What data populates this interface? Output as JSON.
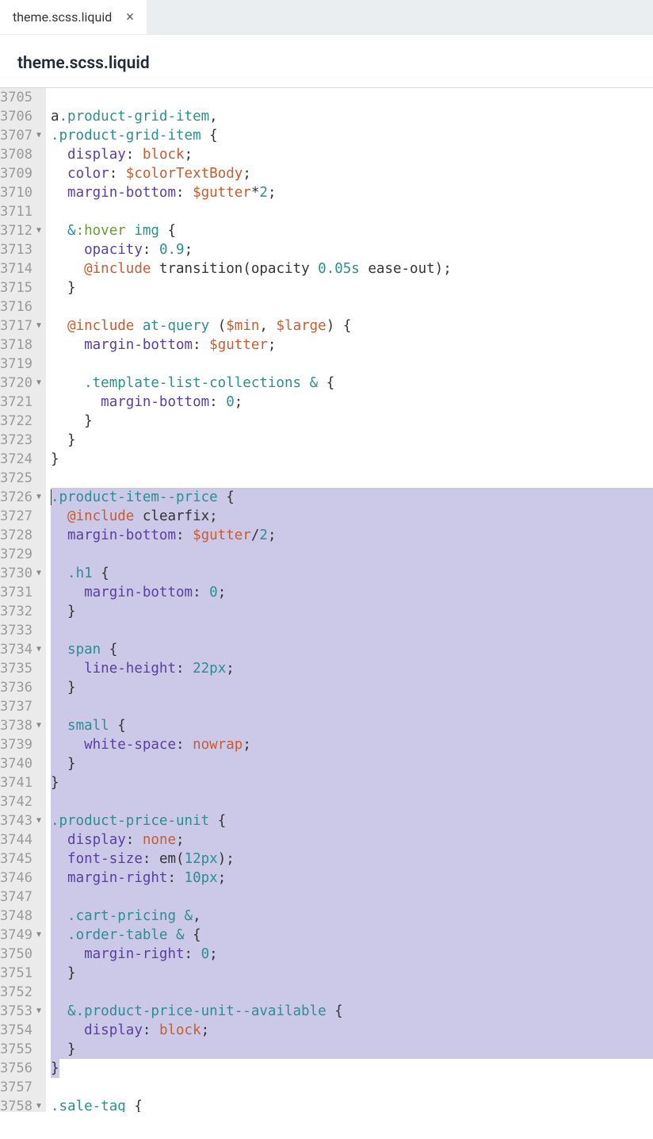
{
  "tab": {
    "label": "theme.scss.liquid",
    "close": "×"
  },
  "breadcrumb": "theme.scss.liquid",
  "gutter": {
    "start": 3705,
    "foldable": [
      3707,
      3712,
      3717,
      3720,
      3726,
      3730,
      3734,
      3738,
      3743,
      3749,
      3753,
      3758
    ]
  },
  "selection": {
    "start": 3726,
    "end": 3756
  },
  "lines": [
    {
      "n": 3705,
      "t": [
        [
          "",
          ""
        ]
      ]
    },
    {
      "n": 3706,
      "t": [
        [
          "a",
          "ident"
        ],
        [
          ".product-grid-item",
          "tag"
        ],
        [
          ",",
          "punc"
        ]
      ]
    },
    {
      "n": 3707,
      "t": [
        [
          ".product-grid-item",
          "tag"
        ],
        [
          " ",
          "ident"
        ],
        [
          "{",
          "punc"
        ]
      ]
    },
    {
      "n": 3708,
      "t": [
        [
          "  ",
          "ident"
        ],
        [
          "display",
          "prop"
        ],
        [
          ": ",
          "punc"
        ],
        [
          "block",
          "val"
        ],
        [
          ";",
          "punc"
        ]
      ]
    },
    {
      "n": 3709,
      "t": [
        [
          "  ",
          "ident"
        ],
        [
          "color",
          "prop"
        ],
        [
          ": ",
          "punc"
        ],
        [
          "$colorTextBody",
          "val"
        ],
        [
          ";",
          "punc"
        ]
      ]
    },
    {
      "n": 3710,
      "t": [
        [
          "  ",
          "ident"
        ],
        [
          "margin-bottom",
          "prop"
        ],
        [
          ": ",
          "punc"
        ],
        [
          "$gutter",
          "val"
        ],
        [
          "*",
          "punc"
        ],
        [
          "2",
          "num"
        ],
        [
          ";",
          "punc"
        ]
      ]
    },
    {
      "n": 3711,
      "t": [
        [
          "",
          ""
        ]
      ]
    },
    {
      "n": 3712,
      "t": [
        [
          "  ",
          "ident"
        ],
        [
          "&",
          "tag"
        ],
        [
          ":hover",
          "pseudo"
        ],
        [
          " ",
          "ident"
        ],
        [
          "img",
          "tag"
        ],
        [
          " ",
          "ident"
        ],
        [
          "{",
          "punc"
        ]
      ]
    },
    {
      "n": 3713,
      "t": [
        [
          "    ",
          "ident"
        ],
        [
          "opacity",
          "prop"
        ],
        [
          ": ",
          "punc"
        ],
        [
          "0.9",
          "num"
        ],
        [
          ";",
          "punc"
        ]
      ]
    },
    {
      "n": 3714,
      "t": [
        [
          "    ",
          "ident"
        ],
        [
          "@include",
          "kw"
        ],
        [
          " ",
          "ident"
        ],
        [
          "transition",
          "ident"
        ],
        [
          "(",
          "punc"
        ],
        [
          "opacity ",
          "ident"
        ],
        [
          "0.05s",
          "num"
        ],
        [
          " ease-out",
          "ident"
        ],
        [
          ")",
          "punc"
        ],
        [
          ";",
          "punc"
        ]
      ]
    },
    {
      "n": 3715,
      "t": [
        [
          "  ",
          "ident"
        ],
        [
          "}",
          "punc"
        ]
      ]
    },
    {
      "n": 3716,
      "t": [
        [
          "",
          ""
        ]
      ]
    },
    {
      "n": 3717,
      "t": [
        [
          "  ",
          "ident"
        ],
        [
          "@include",
          "kw"
        ],
        [
          " ",
          "ident"
        ],
        [
          "at-query",
          "tag"
        ],
        [
          " ",
          "ident"
        ],
        [
          "(",
          "punc"
        ],
        [
          "$min",
          "val"
        ],
        [
          ", ",
          "punc"
        ],
        [
          "$large",
          "val"
        ],
        [
          ")",
          "punc"
        ],
        [
          " ",
          "ident"
        ],
        [
          "{",
          "punc"
        ]
      ]
    },
    {
      "n": 3718,
      "t": [
        [
          "    ",
          "ident"
        ],
        [
          "margin-bottom",
          "prop"
        ],
        [
          ": ",
          "punc"
        ],
        [
          "$gutter",
          "val"
        ],
        [
          ";",
          "punc"
        ]
      ]
    },
    {
      "n": 3719,
      "t": [
        [
          "",
          ""
        ]
      ]
    },
    {
      "n": 3720,
      "t": [
        [
          "    ",
          "ident"
        ],
        [
          ".template-list-collections",
          "tag"
        ],
        [
          " ",
          "ident"
        ],
        [
          "&",
          "tag"
        ],
        [
          " ",
          "ident"
        ],
        [
          "{",
          "punc"
        ]
      ]
    },
    {
      "n": 3721,
      "t": [
        [
          "      ",
          "ident"
        ],
        [
          "margin-bottom",
          "prop"
        ],
        [
          ": ",
          "punc"
        ],
        [
          "0",
          "num"
        ],
        [
          ";",
          "punc"
        ]
      ]
    },
    {
      "n": 3722,
      "t": [
        [
          "    ",
          "ident"
        ],
        [
          "}",
          "punc"
        ]
      ]
    },
    {
      "n": 3723,
      "t": [
        [
          "  ",
          "ident"
        ],
        [
          "}",
          "punc"
        ]
      ]
    },
    {
      "n": 3724,
      "t": [
        [
          "}",
          "punc"
        ]
      ]
    },
    {
      "n": 3725,
      "t": [
        [
          "",
          ""
        ]
      ]
    },
    {
      "n": 3726,
      "t": [
        [
          ".product-item--price",
          "tag"
        ],
        [
          " ",
          "ident"
        ],
        [
          "{",
          "punc"
        ]
      ]
    },
    {
      "n": 3727,
      "t": [
        [
          "  ",
          "ident"
        ],
        [
          "@include",
          "kw"
        ],
        [
          " ",
          "ident"
        ],
        [
          "clearfix",
          "ident"
        ],
        [
          ";",
          "punc"
        ]
      ]
    },
    {
      "n": 3728,
      "t": [
        [
          "  ",
          "ident"
        ],
        [
          "margin-bottom",
          "prop"
        ],
        [
          ": ",
          "punc"
        ],
        [
          "$gutter",
          "val"
        ],
        [
          "/",
          "punc"
        ],
        [
          "2",
          "num"
        ],
        [
          ";",
          "punc"
        ]
      ]
    },
    {
      "n": 3729,
      "t": [
        [
          "",
          ""
        ]
      ]
    },
    {
      "n": 3730,
      "t": [
        [
          "  ",
          "ident"
        ],
        [
          ".h1",
          "tag"
        ],
        [
          " ",
          "ident"
        ],
        [
          "{",
          "punc"
        ]
      ]
    },
    {
      "n": 3731,
      "t": [
        [
          "    ",
          "ident"
        ],
        [
          "margin-bottom",
          "prop"
        ],
        [
          ": ",
          "punc"
        ],
        [
          "0",
          "num"
        ],
        [
          ";",
          "punc"
        ]
      ]
    },
    {
      "n": 3732,
      "t": [
        [
          "  ",
          "ident"
        ],
        [
          "}",
          "punc"
        ]
      ]
    },
    {
      "n": 3733,
      "t": [
        [
          "",
          ""
        ]
      ]
    },
    {
      "n": 3734,
      "t": [
        [
          "  ",
          "ident"
        ],
        [
          "span",
          "tag"
        ],
        [
          " ",
          "ident"
        ],
        [
          "{",
          "punc"
        ]
      ]
    },
    {
      "n": 3735,
      "t": [
        [
          "    ",
          "ident"
        ],
        [
          "line-height",
          "prop"
        ],
        [
          ": ",
          "punc"
        ],
        [
          "22px",
          "num"
        ],
        [
          ";",
          "punc"
        ]
      ]
    },
    {
      "n": 3736,
      "t": [
        [
          "  ",
          "ident"
        ],
        [
          "}",
          "punc"
        ]
      ]
    },
    {
      "n": 3737,
      "t": [
        [
          "",
          ""
        ]
      ]
    },
    {
      "n": 3738,
      "t": [
        [
          "  ",
          "ident"
        ],
        [
          "small",
          "tag"
        ],
        [
          " ",
          "ident"
        ],
        [
          "{",
          "punc"
        ]
      ]
    },
    {
      "n": 3739,
      "t": [
        [
          "    ",
          "ident"
        ],
        [
          "white-space",
          "prop"
        ],
        [
          ": ",
          "punc"
        ],
        [
          "nowrap",
          "val"
        ],
        [
          ";",
          "punc"
        ]
      ]
    },
    {
      "n": 3740,
      "t": [
        [
          "  ",
          "ident"
        ],
        [
          "}",
          "punc"
        ]
      ]
    },
    {
      "n": 3741,
      "t": [
        [
          "}",
          "punc"
        ]
      ]
    },
    {
      "n": 3742,
      "t": [
        [
          "",
          ""
        ]
      ]
    },
    {
      "n": 3743,
      "t": [
        [
          ".product-price-unit",
          "tag"
        ],
        [
          " ",
          "ident"
        ],
        [
          "{",
          "punc"
        ]
      ]
    },
    {
      "n": 3744,
      "t": [
        [
          "  ",
          "ident"
        ],
        [
          "display",
          "prop"
        ],
        [
          ": ",
          "punc"
        ],
        [
          "none",
          "val"
        ],
        [
          ";",
          "punc"
        ]
      ]
    },
    {
      "n": 3745,
      "t": [
        [
          "  ",
          "ident"
        ],
        [
          "font-size",
          "prop"
        ],
        [
          ": ",
          "punc"
        ],
        [
          "em",
          "ident"
        ],
        [
          "(",
          "punc"
        ],
        [
          "12px",
          "num"
        ],
        [
          ")",
          "punc"
        ],
        [
          ";",
          "punc"
        ]
      ]
    },
    {
      "n": 3746,
      "t": [
        [
          "  ",
          "ident"
        ],
        [
          "margin-right",
          "prop"
        ],
        [
          ": ",
          "punc"
        ],
        [
          "10px",
          "num"
        ],
        [
          ";",
          "punc"
        ]
      ]
    },
    {
      "n": 3747,
      "t": [
        [
          "",
          ""
        ]
      ]
    },
    {
      "n": 3748,
      "t": [
        [
          "  ",
          "ident"
        ],
        [
          ".cart-pricing",
          "tag"
        ],
        [
          " ",
          "ident"
        ],
        [
          "&",
          "tag"
        ],
        [
          ",",
          "punc"
        ]
      ]
    },
    {
      "n": 3749,
      "t": [
        [
          "  ",
          "ident"
        ],
        [
          ".order-table",
          "tag"
        ],
        [
          " ",
          "ident"
        ],
        [
          "&",
          "tag"
        ],
        [
          " ",
          "ident"
        ],
        [
          "{",
          "punc"
        ]
      ]
    },
    {
      "n": 3750,
      "t": [
        [
          "    ",
          "ident"
        ],
        [
          "margin-right",
          "prop"
        ],
        [
          ": ",
          "punc"
        ],
        [
          "0",
          "num"
        ],
        [
          ";",
          "punc"
        ]
      ]
    },
    {
      "n": 3751,
      "t": [
        [
          "  ",
          "ident"
        ],
        [
          "}",
          "punc"
        ]
      ]
    },
    {
      "n": 3752,
      "t": [
        [
          "",
          ""
        ]
      ]
    },
    {
      "n": 3753,
      "t": [
        [
          "  ",
          "ident"
        ],
        [
          "&",
          "tag"
        ],
        [
          ".product-price-unit--available",
          "tag"
        ],
        [
          " ",
          "ident"
        ],
        [
          "{",
          "punc"
        ]
      ]
    },
    {
      "n": 3754,
      "t": [
        [
          "    ",
          "ident"
        ],
        [
          "display",
          "prop"
        ],
        [
          ": ",
          "punc"
        ],
        [
          "block",
          "val"
        ],
        [
          ";",
          "punc"
        ]
      ]
    },
    {
      "n": 3755,
      "t": [
        [
          "  ",
          "ident"
        ],
        [
          "}",
          "punc"
        ]
      ]
    },
    {
      "n": 3756,
      "t": [
        [
          "}",
          "punc"
        ]
      ]
    },
    {
      "n": 3757,
      "t": [
        [
          "",
          ""
        ]
      ]
    },
    {
      "n": 3758,
      "t": [
        [
          ".sale-tag",
          "tag"
        ],
        [
          " ",
          "ident"
        ],
        [
          "{",
          "punc"
        ]
      ]
    }
  ]
}
